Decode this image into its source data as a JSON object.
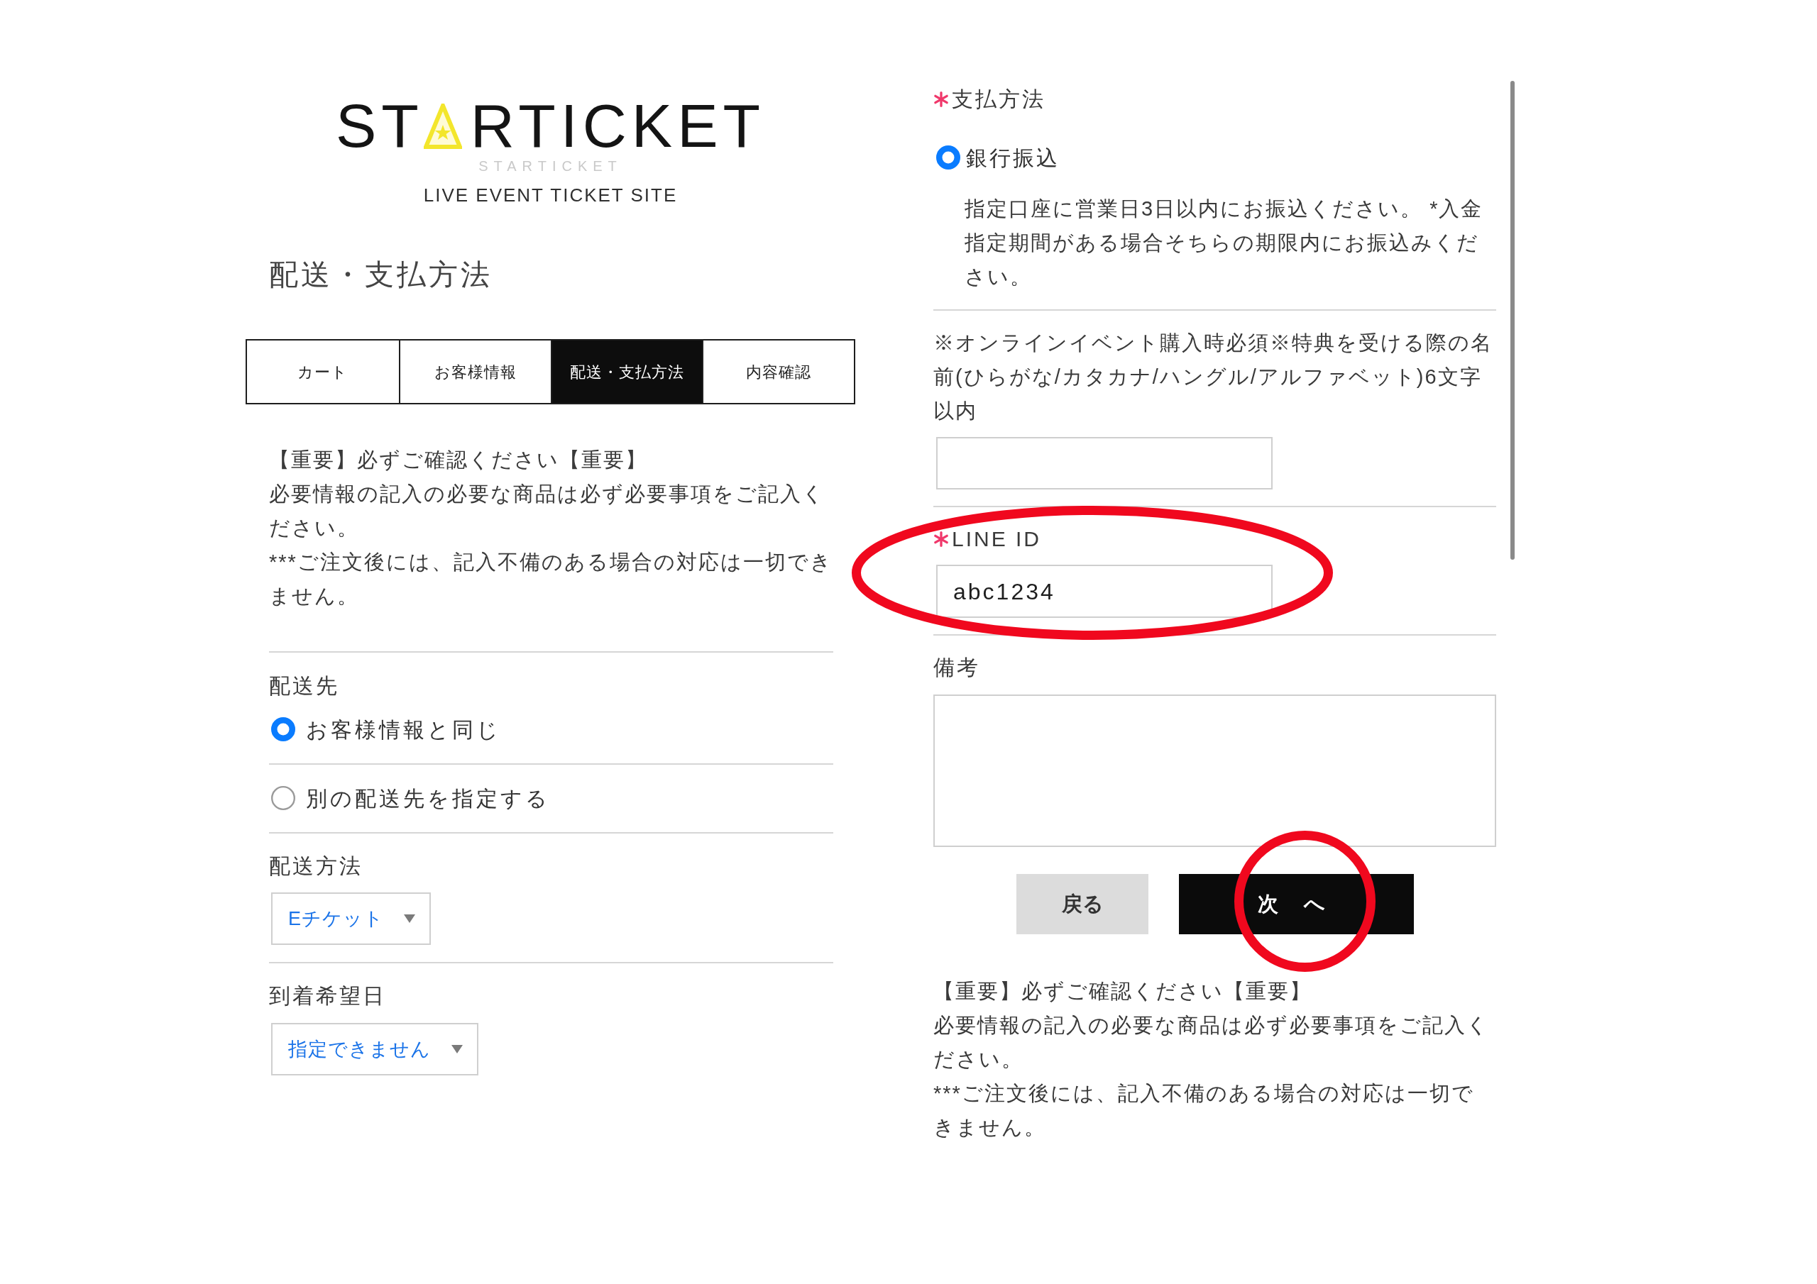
{
  "logo": {
    "wordmark_start": "ST",
    "wordmark_end": "RTICKET",
    "subtitle": "STARTICKET",
    "tagline": "LIVE EVENT TICKET SITE"
  },
  "page_title": "配送・支払方法",
  "steps": [
    {
      "label": "カート",
      "selected": false
    },
    {
      "label": "お客様情報",
      "selected": false
    },
    {
      "label": "配送・支払方法",
      "selected": true
    },
    {
      "label": "内容確認",
      "selected": false
    }
  ],
  "notice_top": {
    "lines": [
      "【重要】必ずご確認ください【重要】",
      "必要情報の記入の必要な商品は必ず必要事項をご記入ください。",
      "***ご注文後には、記入不備のある場合の対応は一切できません。"
    ]
  },
  "delivery_destination": {
    "label": "配送先",
    "options": [
      {
        "label": "お客様情報と同じ",
        "selected": true
      },
      {
        "label": "別の配送先を指定する",
        "selected": false
      }
    ]
  },
  "delivery_method": {
    "label": "配送方法",
    "value": "Eチケット"
  },
  "arrival_date": {
    "label": "到着希望日",
    "value": "指定できません"
  },
  "payment": {
    "label": "支払方法",
    "required": true,
    "options": [
      {
        "label": "銀行振込",
        "selected": true,
        "description": "指定口座に営業日3日以内にお振込ください。 *入金指定期間がある場合そちらの期限内にお振込みください。"
      }
    ]
  },
  "bonus_name": {
    "label": "※オンラインイベント購入時必須※特典を受ける際の名前(ひらがな/カタカナ/ハングル/アルファベット)6文字以内"
  },
  "line_id": {
    "label": "LINE ID",
    "required": true,
    "value": "abc1234",
    "highlighted": true
  },
  "remarks": {
    "label": "備考"
  },
  "buttons": [
    {
      "label": "戻る",
      "kind": "secondary"
    },
    {
      "label": "次 へ",
      "kind": "primary",
      "highlighted": true
    }
  ],
  "notice_bottom": {
    "lines": [
      "【重要】必ずご確認ください【重要】",
      "必要情報の記入の必要な商品は必ず必要事項をご記入ください。",
      "***ご注文後には、記入不備のある場合の対応は一切できません。"
    ]
  }
}
